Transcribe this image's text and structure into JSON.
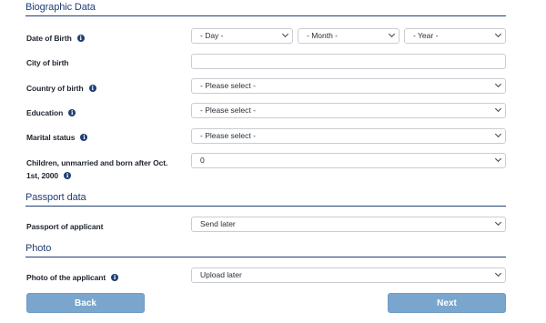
{
  "sections": {
    "biographic": "Biographic Data",
    "passport": "Passport data",
    "photo": "Photo"
  },
  "fields": {
    "dob_label": "Date of Birth",
    "dob_day": "- Day -",
    "dob_month": "- Month -",
    "dob_year": "- Year -",
    "city_label": "City of birth",
    "city_value": "",
    "country_label": "Country of birth",
    "country_value": "- Please select -",
    "education_label": "Education",
    "education_value": "- Please select -",
    "marital_label": "Marital status",
    "marital_value": "- Please select -",
    "children_label_line1": "Children, unmarried and born after Oct.",
    "children_label_line2": "1st, 2000",
    "children_value": "0",
    "passport_label": "Passport of applicant",
    "passport_value": "Send later",
    "photo_label": "Photo of the applicant",
    "photo_value": "Upload later"
  },
  "buttons": {
    "back": "Back",
    "next": "Next"
  },
  "colors": {
    "accent": "#1f3f73",
    "button": "#7aa6cd"
  },
  "icons": {
    "info": "info-icon",
    "chevron": "chevron-down-icon"
  }
}
